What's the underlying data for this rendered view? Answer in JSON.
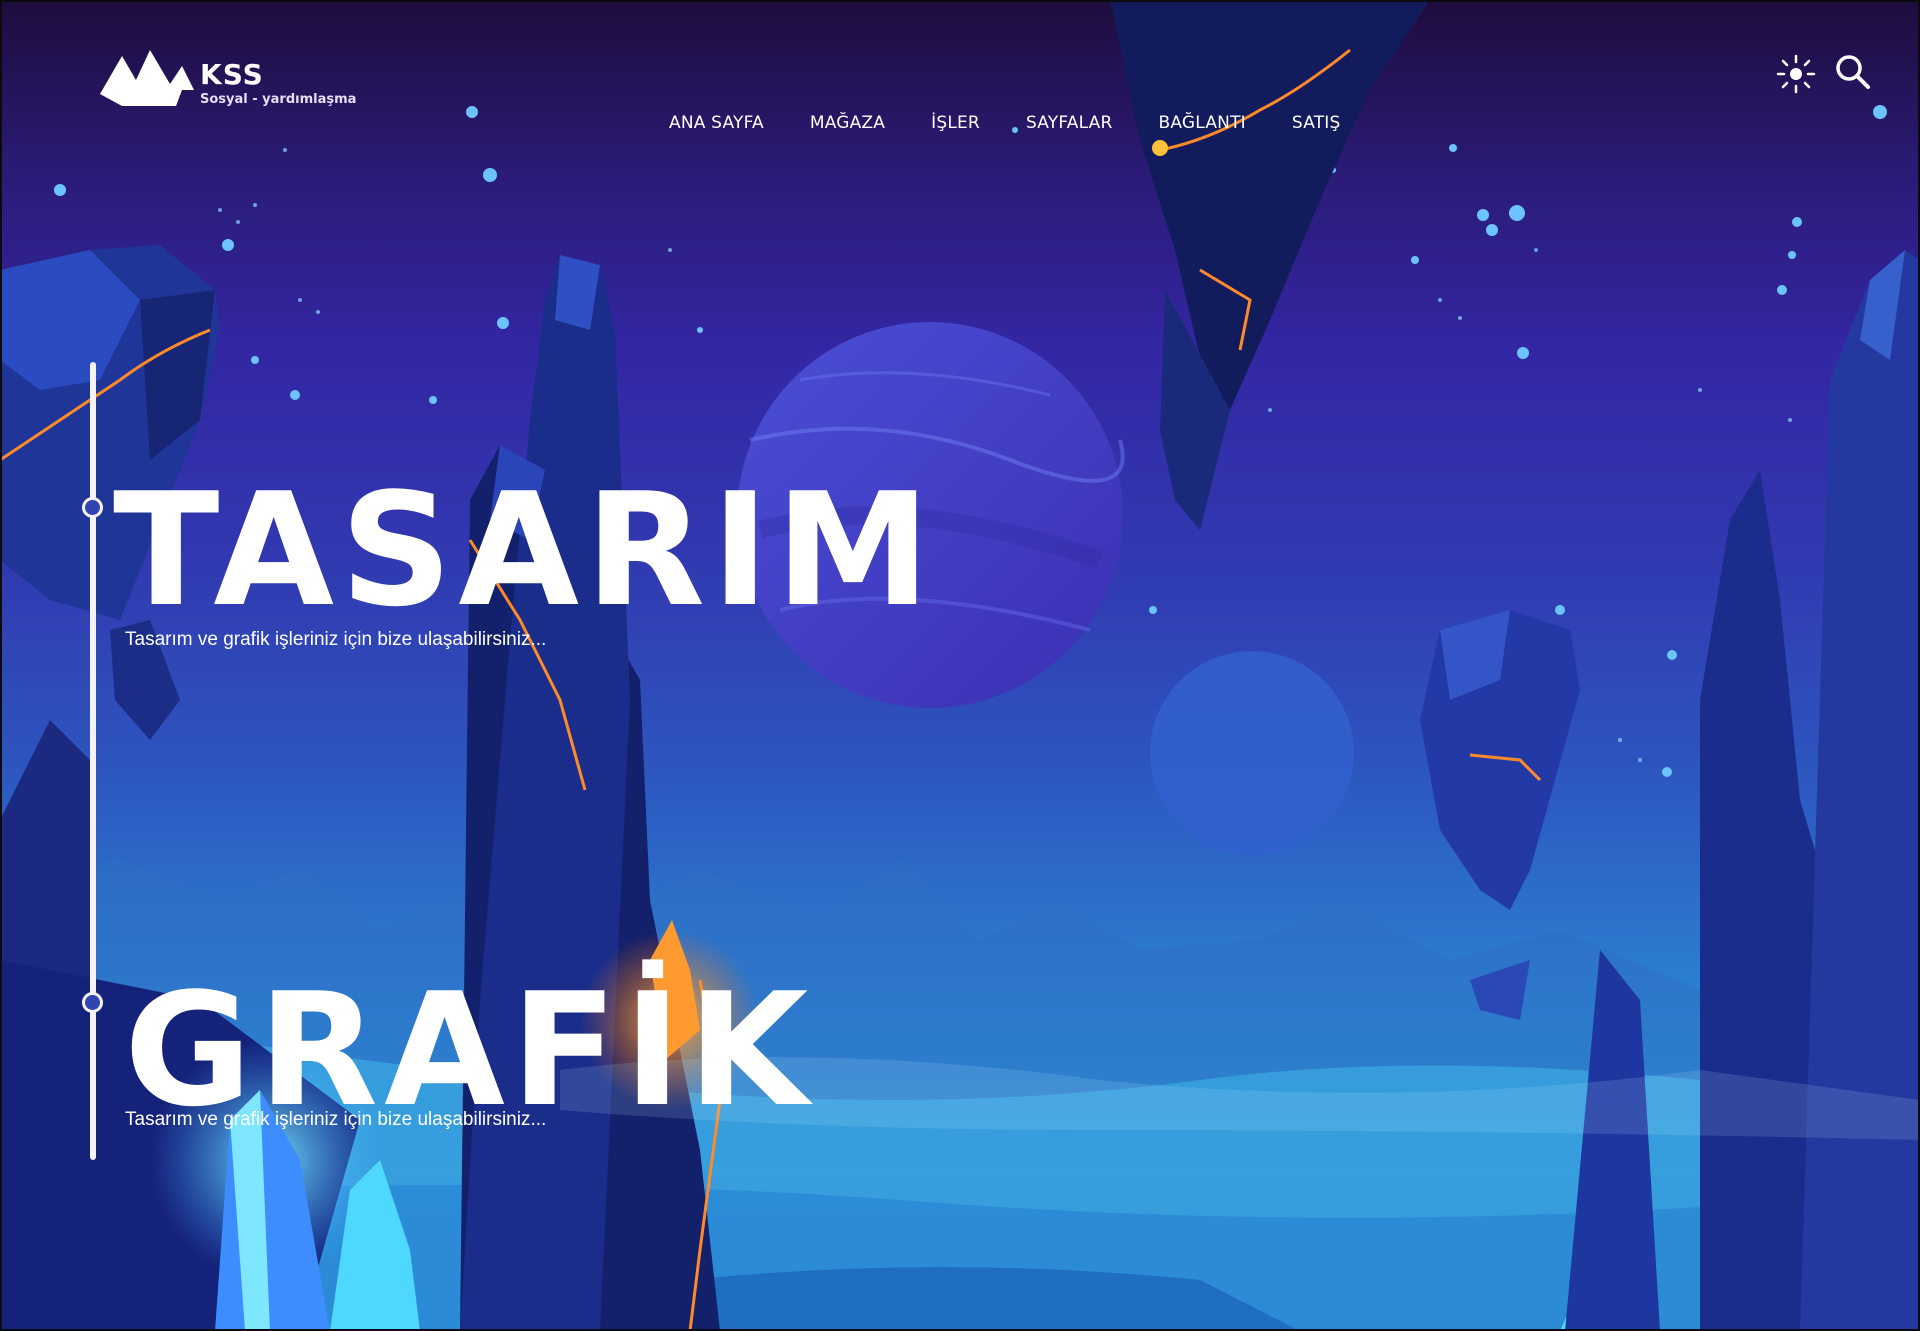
{
  "brand": {
    "name": "KSS",
    "tagline": "Sosyal - yardımlaşma"
  },
  "nav": {
    "items": [
      {
        "label": "ANA SAYFA"
      },
      {
        "label": "MAĞAZA"
      },
      {
        "label": "İŞLER"
      },
      {
        "label": "SAYFALAR"
      },
      {
        "label": "BAĞLANTI"
      },
      {
        "label": "SATIŞ"
      }
    ]
  },
  "toolbar": {
    "theme_icon": "sun-icon",
    "search_icon": "search-icon"
  },
  "hero": {
    "slides": [
      {
        "title": "TASARIM",
        "subtitle": "Tasarım ve grafik işleriniz için bize ulaşabilirsiniz..."
      },
      {
        "title": "GRAFİK",
        "subtitle": "Tasarım ve grafik işleriniz için bize ulaşabilirsiniz..."
      }
    ]
  },
  "colors": {
    "sky_top": "#1e0c3c",
    "sky_mid": "#3326a3",
    "sky_bottom": "#2ea3de",
    "rock_dark": "#13206b",
    "rock_mid": "#2a3cab",
    "lava": "#ff8a2a",
    "crystal": "#4fd8ff"
  }
}
